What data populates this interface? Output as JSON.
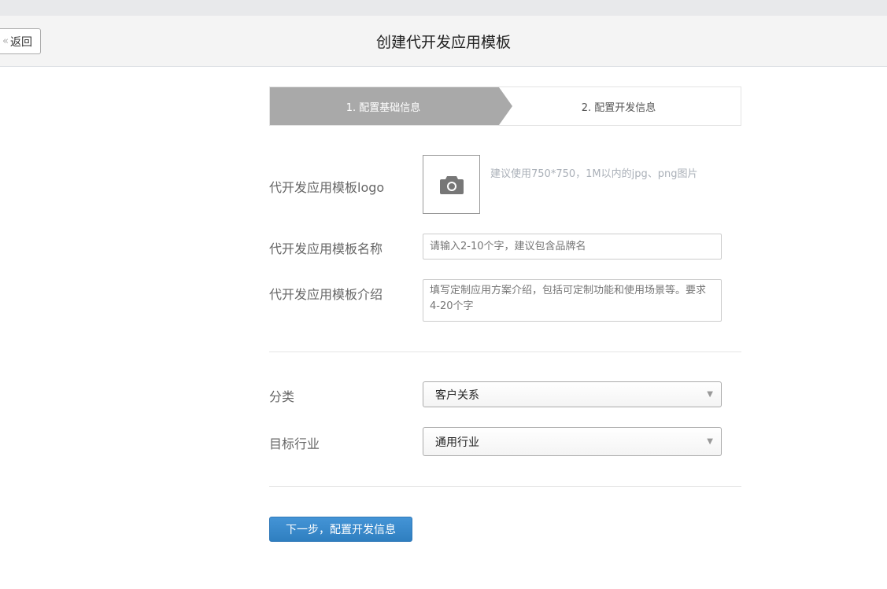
{
  "header": {
    "back_label": "返回",
    "title": "创建代开发应用模板"
  },
  "steps": [
    {
      "label": "1. 配置基础信息",
      "active": true
    },
    {
      "label": "2. 配置开发信息",
      "active": false
    }
  ],
  "form": {
    "logo": {
      "label": "代开发应用模板logo",
      "hint": "建议使用750*750，1M以内的jpg、png图片",
      "icon": "camera-icon"
    },
    "name": {
      "label": "代开发应用模板名称",
      "placeholder": "请输入2-10个字，建议包含品牌名"
    },
    "intro": {
      "label": "代开发应用模板介绍",
      "placeholder": "填写定制应用方案介绍，包括可定制功能和使用场景等。要求4-20个字"
    },
    "category": {
      "label": "分类",
      "value": "客户关系"
    },
    "industry": {
      "label": "目标行业",
      "value": "通用行业"
    }
  },
  "next_button": "下一步，配置开发信息",
  "colors": {
    "primary": "#3a87c8",
    "step_active": "#a9a9a9"
  }
}
